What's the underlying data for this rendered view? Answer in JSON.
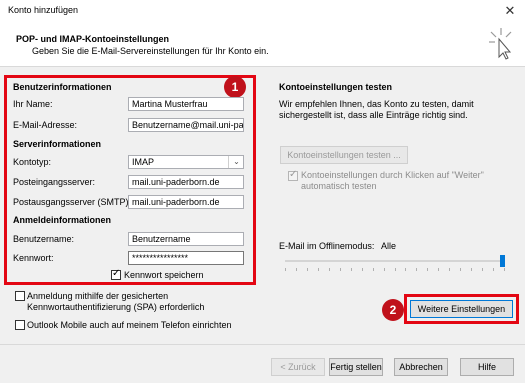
{
  "window": {
    "title": "Konto hinzufügen",
    "close_glyph": "✕"
  },
  "header": {
    "title": "POP- und IMAP-Kontoeinstellungen",
    "subtitle": "Geben Sie die E-Mail-Servereinstellungen für Ihr Konto ein."
  },
  "left": {
    "section_user": "Benutzerinformationen",
    "name_label": "Ihr Name:",
    "name_value": "Martina Musterfrau",
    "email_label": "E-Mail-Adresse:",
    "email_value": "Benutzername@mail.uni-paderborn.de",
    "section_server": "Serverinformationen",
    "type_label": "Kontotyp:",
    "type_value": "IMAP",
    "incoming_label": "Posteingangsserver:",
    "incoming_value": "mail.uni-paderborn.de",
    "outgoing_label": "Postausgangsserver (SMTP):",
    "outgoing_value": "mail.uni-paderborn.de",
    "section_login": "Anmeldeinformationen",
    "username_label": "Benutzername:",
    "username_value": "Benutzername",
    "password_label": "Kennwort:",
    "password_value": "****************",
    "remember_password": "Kennwort speichern",
    "spa_label_line1": "Anmeldung mithilfe der gesicherten",
    "spa_label_line2": "Kennwortauthentifizierung (SPA) erforderlich",
    "outlook_mobile": "Outlook Mobile auch auf meinem Telefon einrichten"
  },
  "right": {
    "test_title": "Kontoeinstellungen testen",
    "test_desc_line1": "Wir empfehlen Ihnen, das Konto zu testen, damit",
    "test_desc_line2": "sichergestellt ist, dass alle Einträge richtig sind.",
    "test_button": "Kontoeinstellungen testen ...",
    "auto_test_line1": "Kontoeinstellungen durch Klicken auf \"Weiter\"",
    "auto_test_line2": "automatisch testen",
    "offline_label": "E-Mail im Offlinemodus:",
    "offline_value": "Alle",
    "offline_level": 1.0,
    "more_settings": "Weitere Einstellungen"
  },
  "badges": {
    "one": "1",
    "two": "2"
  },
  "footer": {
    "back": "< Zurück",
    "finish": "Fertig stellen",
    "cancel": "Abbrechen",
    "help": "Hilfe"
  },
  "colors": {
    "highlight": "#e30613",
    "badge": "#c0111b",
    "accent": "#0078d7"
  }
}
